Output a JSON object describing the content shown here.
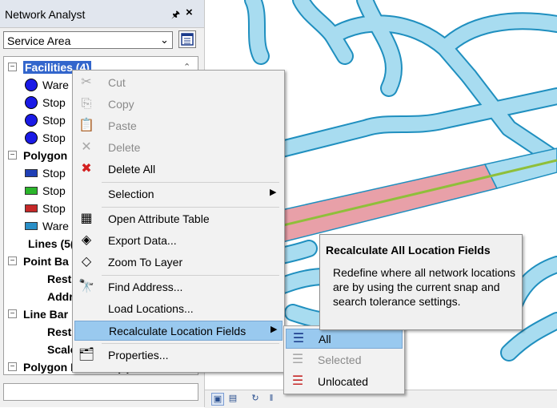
{
  "panel": {
    "title": "Network Analyst",
    "pin_glyph": "📌",
    "close_glyph": "×",
    "analysis_dropdown": {
      "value": "Service Area"
    },
    "tree": [
      {
        "type": "group",
        "label": "Facilities (4)",
        "highlight": true
      },
      {
        "type": "point",
        "label": "Ware"
      },
      {
        "type": "point",
        "label": "Stop"
      },
      {
        "type": "point",
        "label": "Stop"
      },
      {
        "type": "point",
        "label": "Stop"
      },
      {
        "type": "group",
        "label": "Polygon"
      },
      {
        "type": "polygon",
        "label": "Stop",
        "color": "#1f3fb5"
      },
      {
        "type": "polygon",
        "label": "Stop",
        "color": "#2bb52b"
      },
      {
        "type": "polygon",
        "label": "Stop",
        "color": "#c62828"
      },
      {
        "type": "polygon",
        "label": "Ware",
        "color": "#2a8fc7"
      },
      {
        "type": "leaf",
        "label": "Lines (5("
      },
      {
        "type": "group",
        "label": "Point Ba"
      },
      {
        "type": "subleaf",
        "label": "Rest"
      },
      {
        "type": "subleaf",
        "label": "Addr"
      },
      {
        "type": "group",
        "label": "Line Bar"
      },
      {
        "type": "subleaf",
        "label": "Rest"
      },
      {
        "type": "subleaf",
        "label": "Scale"
      },
      {
        "type": "group",
        "label": "Polygon Barriers (0)"
      }
    ]
  },
  "context_menu": {
    "items": [
      {
        "label": "Cut",
        "icon": "scissors-icon",
        "glyph": "✂",
        "disabled": true
      },
      {
        "label": "Copy",
        "icon": "copy-icon",
        "glyph": "⎘",
        "disabled": true
      },
      {
        "label": "Paste",
        "icon": "paste-icon",
        "glyph": "📋",
        "disabled": true
      },
      {
        "label": "Delete",
        "icon": "delete-icon",
        "glyph": "✕",
        "disabled": true
      },
      {
        "label": "Delete All",
        "icon": "delete-all-icon",
        "glyph": "✖",
        "disabled": false,
        "color": "#d32020"
      },
      {
        "label": "Selection",
        "submenu": true,
        "separator_before": true
      },
      {
        "label": "Open Attribute Table",
        "icon": "table-icon",
        "glyph": "▦",
        "separator_before": true
      },
      {
        "label": "Export Data...",
        "icon": "export-icon",
        "glyph": "◈"
      },
      {
        "label": "Zoom To Layer",
        "icon": "zoom-layer-icon",
        "glyph": "◇"
      },
      {
        "label": "Find Address...",
        "icon": "binoculars-icon",
        "glyph": "🔭",
        "separator_before": true
      },
      {
        "label": "Load Locations..."
      },
      {
        "label": "Recalculate Location Fields",
        "submenu": true,
        "highlighted": true
      },
      {
        "label": "Properties...",
        "icon": "properties-icon",
        "glyph": "🗂",
        "separator_before": true
      }
    ]
  },
  "submenu": {
    "items": [
      {
        "label": "All",
        "icon": "recalc-all-icon",
        "glyph": "☰",
        "highlighted": true
      },
      {
        "label": "Selected",
        "icon": "recalc-selected-icon",
        "glyph": "☰",
        "disabled": true
      },
      {
        "label": "Unlocated",
        "icon": "recalc-unlocated-icon",
        "glyph": "☰",
        "color": "#c62828"
      }
    ]
  },
  "tooltip": {
    "title": "Recalculate All Location Fields",
    "body": "Redefine where all network locations are by using the current snap and search tolerance settings."
  },
  "colors": {
    "road_fill": "#a8dcf0",
    "road_edge": "#1f8fbf",
    "service_area": "#e8a0a8",
    "route_line": "#8fbf3a",
    "menu_highlight": "#99c9ef"
  }
}
